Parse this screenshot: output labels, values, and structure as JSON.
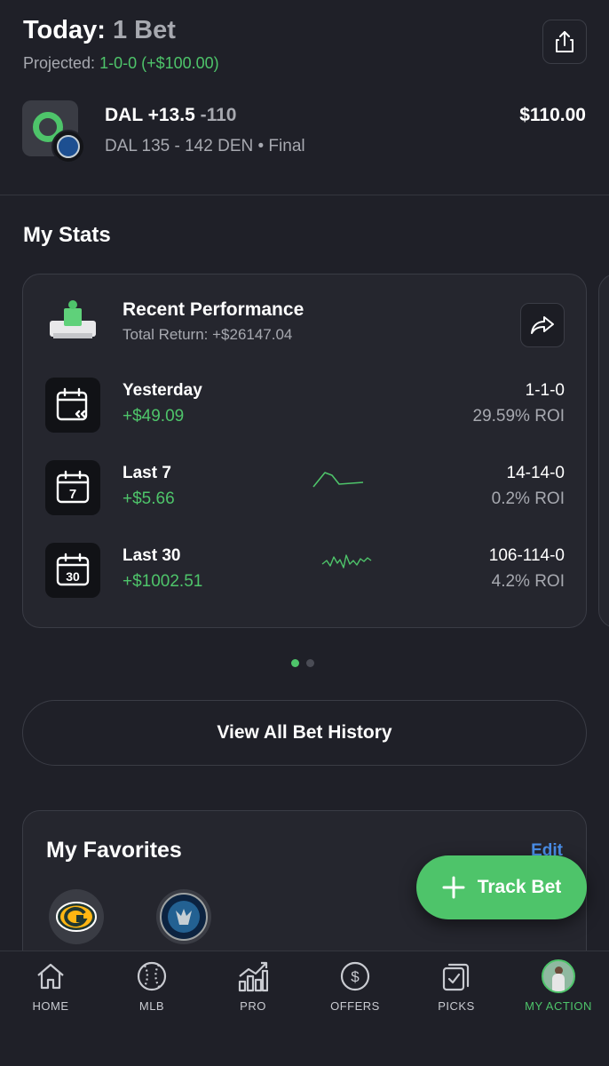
{
  "header": {
    "title_prefix": "Today:",
    "title_count": "1 Bet",
    "projected_label": "Projected:",
    "projected_value": "1-0-0 (+$100.00)"
  },
  "bet": {
    "line": "DAL +13.5",
    "odds": "-110",
    "amount": "$110.00",
    "result": "DAL 135 - 142 DEN • Final"
  },
  "stats": {
    "section_title": "My Stats",
    "card_title": "Recent Performance",
    "card_subtitle": "Total Return: +$26147.04",
    "rows": [
      {
        "label": "Yesterday",
        "amount": "+$49.09",
        "record": "1-1-0",
        "roi": "29.59% ROI",
        "icon": "calendar-rewind-icon"
      },
      {
        "label": "Last 7",
        "amount": "+$5.66",
        "record": "14-14-0",
        "roi": "0.2% ROI",
        "icon": "calendar-7-icon",
        "calendar_number": "7"
      },
      {
        "label": "Last 30",
        "amount": "+$1002.51",
        "record": "106-114-0",
        "roi": "4.2% ROI",
        "icon": "calendar-30-icon",
        "calendar_number": "30"
      }
    ],
    "pager": {
      "pages": 2,
      "active": 1
    }
  },
  "history_button": "View All Bet History",
  "favorites": {
    "title": "My Favorites",
    "edit": "Edit",
    "teams": [
      "green-bay-packers-logo",
      "minnesota-timberwolves-logo"
    ]
  },
  "track_button": "Track Bet",
  "nav": [
    {
      "label": "HOME",
      "icon": "home-icon"
    },
    {
      "label": "MLB",
      "icon": "baseball-icon"
    },
    {
      "label": "PRO",
      "icon": "chart-bars-icon"
    },
    {
      "label": "OFFERS",
      "icon": "dollar-circle-icon"
    },
    {
      "label": "PICKS",
      "icon": "picks-check-icon"
    },
    {
      "label": "MY ACTION",
      "icon": "avatar-icon",
      "active": true
    }
  ],
  "colors": {
    "background": "#1f2028",
    "card": "#25262e",
    "accent_green": "#4ec46a",
    "edit_blue": "#4a8ee8",
    "muted_text": "#a7a9b0"
  }
}
